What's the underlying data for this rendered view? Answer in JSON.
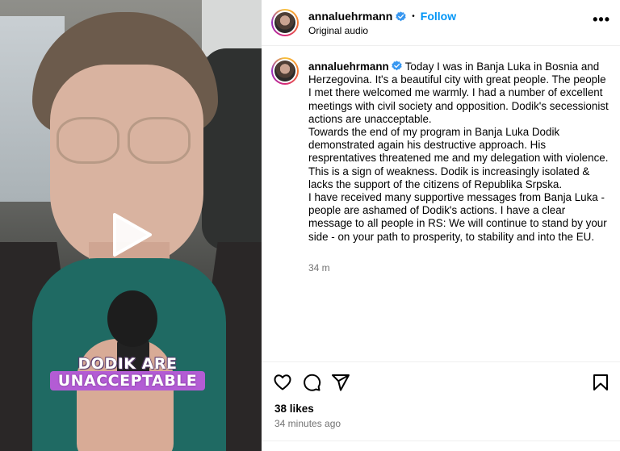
{
  "video": {
    "caption_line1": "DODIK ARE",
    "caption_line2": "UNACCEPTABLE",
    "play_icon": "play-icon"
  },
  "header": {
    "username": "annaluehrmann",
    "separator": "•",
    "follow_label": "Follow",
    "audio_label": "Original audio",
    "more_icon": "more-options-icon",
    "more_glyph": "•••"
  },
  "post": {
    "username": "annaluehrmann",
    "paragraphs": [
      "Today I was in Banja Luka in Bosnia and Herzegovina. It's a beautiful city with great people. The people I met there welcomed me warmly. I had a number of excellent meetings with civil society and opposition. Dodik's secessionist actions are unacceptable.",
      "Towards the end of my program in Banja Luka Dodik demonstrated again his destructive approach. His resprentatives threatened me and my delegation with violence. This is a sign of weakness. Dodik is increasingly isolated & lacks the support of the citizens of Republika Srpska.",
      "I have received many supportive messages from Banja Luka - people are ashamed of Dodik's actions. I have a clear message to all people in RS: We will continue to stand by your side - on your path to prosperity, to stability and into the EU."
    ],
    "time_ago": "34 m"
  },
  "actions": {
    "icons": [
      "heart-icon",
      "comment-icon",
      "share-icon",
      "bookmark-icon"
    ]
  },
  "stats": {
    "likes": "38 likes",
    "posted": "34 minutes ago"
  },
  "colors": {
    "link_blue": "#0095f6",
    "verified_blue": "#3897f0",
    "muted_text": "#737373",
    "caption_highlight": "#b35cd4"
  }
}
